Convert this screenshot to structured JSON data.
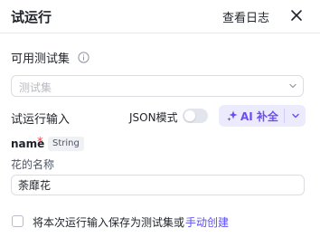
{
  "header": {
    "title": "试运行",
    "view_log": "查看日志",
    "close_icon": "close-icon"
  },
  "testset": {
    "label": "可用测试集",
    "info_icon": "info-icon",
    "select_placeholder": "测试集",
    "chevron_icon": "chevron-down-icon"
  },
  "run_input": {
    "label": "试运行输入",
    "json_mode_label": "JSON模式",
    "json_mode_enabled": false,
    "ai_button_label": "AI 补全",
    "ai_icon": "sparkle-icon",
    "ai_dropdown_icon": "chevron-down-icon"
  },
  "field": {
    "name": "name",
    "required_mark": "*",
    "type": "String",
    "description": "花的名称",
    "value": "荼靡花"
  },
  "footer": {
    "checkbox_checked": false,
    "save_text": "将本次运行输入保存为测试集或",
    "manual_create_link": "手动创建"
  },
  "colors": {
    "accent": "#5b4ef0",
    "ai_button_bg": "#eceafd",
    "required": "#e5484d",
    "border": "#dcdde3"
  }
}
